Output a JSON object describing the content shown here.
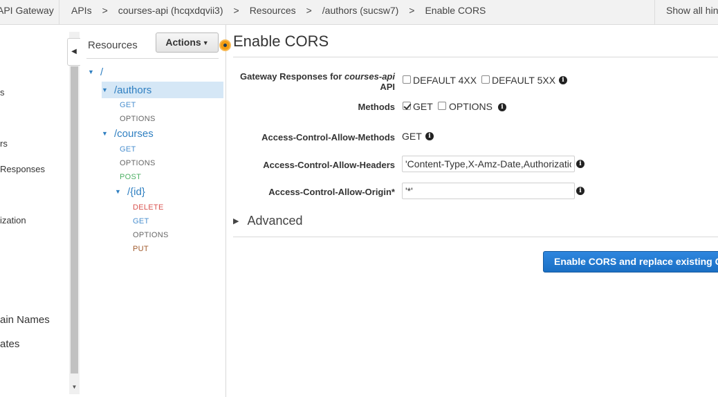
{
  "topbar": {
    "brand": "API Gateway",
    "breadcrumbs": [
      "APIs",
      "courses-api (hcqxdqvii3)",
      "Resources",
      "/authors (sucsw7)",
      "Enable CORS"
    ],
    "separator": ">",
    "hints": "Show all hints"
  },
  "leftnav": {
    "items": [
      "s",
      "rs",
      "Responses",
      "ization",
      "ain Names",
      "ates"
    ]
  },
  "resources": {
    "title": "Resources",
    "actions_label": "Actions",
    "tree": {
      "root": "/",
      "authors": "/authors",
      "authors_methods": [
        "GET",
        "OPTIONS"
      ],
      "courses": "/courses",
      "courses_methods": [
        "GET",
        "OPTIONS",
        "POST"
      ],
      "id": "/{id}",
      "id_methods": [
        "DELETE",
        "GET",
        "OPTIONS",
        "PUT"
      ]
    }
  },
  "form": {
    "title": "Enable CORS",
    "gateway_responses_label_prefix": "Gateway Responses for ",
    "gateway_responses_api": "courses-api",
    "gateway_responses_label_suffix": "API",
    "default_4xx": "DEFAULT 4XX",
    "default_5xx": "DEFAULT 5XX",
    "methods_label": "Methods",
    "method_get": "GET",
    "method_options": "OPTIONS",
    "allow_methods_label": "Access-Control-Allow-Methods",
    "allow_methods_value": "GET",
    "allow_headers_label": "Access-Control-Allow-Headers",
    "allow_headers_value": "'Content-Type,X-Amz-Date,Authorization,X-Api-Key,X-Amz-Security-Token'",
    "allow_origin_label": "Access-Control-Allow-Origin*",
    "allow_origin_value": "'*'",
    "advanced_label": "Advanced",
    "submit_label": "Enable CORS and replace existing CORS headers",
    "default_4xx_checked": false,
    "default_5xx_checked": false,
    "get_checked": true,
    "options_checked": false
  },
  "colors": {
    "accent": "#1a6fc4",
    "selected_bg": "#d5e7f6",
    "link": "#2f7fc1",
    "get": "#4a8fcf",
    "post": "#4caf63",
    "delete": "#d9534f",
    "put": "#a05a2c",
    "orange": "#f39c12"
  }
}
